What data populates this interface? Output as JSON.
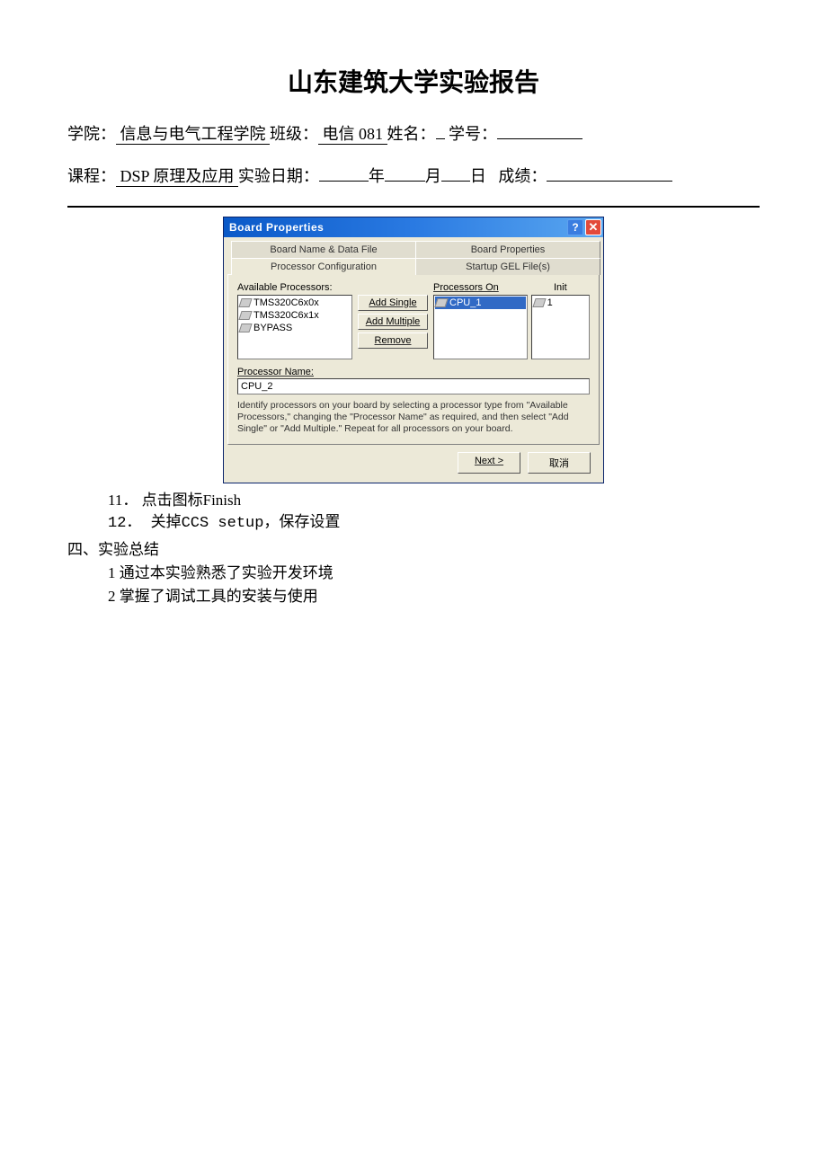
{
  "header": {
    "title": "山东建筑大学实验报告",
    "school_label": "学院：",
    "school": "  信息与电气工程学院  ",
    "class_label": "班级：",
    "class": " 电信 081 ",
    "name_label": "姓名：",
    "id_label": "学号：",
    "course_label": "课程：",
    "course": "  DSP 原理及应用  ",
    "date_label": "实验日期：",
    "year_label": "年",
    "month_label": "月",
    "day_label": "日",
    "grade_label": "成绩："
  },
  "dialog": {
    "title": "Board Properties",
    "tabs": {
      "t0": "Board Name & Data File",
      "t1": "Board Properties",
      "t2": "Processor Configuration",
      "t3": "Startup GEL File(s)"
    },
    "labels": {
      "available": "Available Processors:",
      "procs_on": "Processors On",
      "init": "Init",
      "add_single": "Add Single",
      "add_multiple": "Add Multiple",
      "remove": "Remove",
      "proc_name": "Processor Name:"
    },
    "available_items": {
      "i0": "TMS320C6x0x",
      "i1": "TMS320C6x1x",
      "i2": "BYPASS"
    },
    "procs_on_items": {
      "i0": "CPU_1"
    },
    "init_items": {
      "i0": "1"
    },
    "proc_name_value": "CPU_2",
    "hint": "Identify processors on your board by selecting a processor type from \"Available Processors,\" changing the \"Processor Name\" as required, and then select \"Add Single\" or \"Add Multiple.\"  Repeat for all processors on your board.",
    "next": "Next >",
    "cancel": "取消"
  },
  "content": {
    "s11": "11．  点击图标Finish",
    "s12": "12．  关掉CCS setup，保存设置",
    "h4": "四、实验总结",
    "l1": "1 通过本实验熟悉了实验开发环境",
    "l2": "2 掌握了调试工具的安装与使用"
  }
}
